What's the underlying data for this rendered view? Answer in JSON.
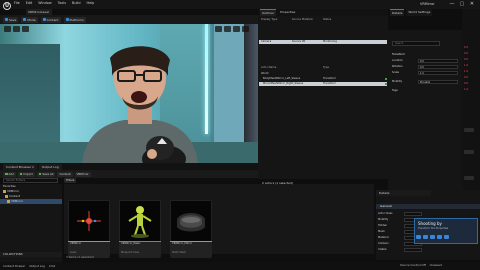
{
  "app": {
    "logo": "U",
    "menu": [
      "File",
      "Edit",
      "Window",
      "Tools",
      "Build",
      "Help"
    ],
    "project_name": "VRMirror",
    "window_controls": [
      "—",
      "▢",
      "✕"
    ],
    "level_tab": "VRMirrorLevel"
  },
  "main_toolbar": {
    "buttons": [
      "Save",
      "Mode",
      "Content",
      "Platforms"
    ]
  },
  "viewport": {
    "scene": "webcam-capture",
    "accent_colors": {
      "light_strip": "#aef6ff",
      "wall": "#5ea9b1"
    }
  },
  "drawer": {
    "tabs": [
      "Content Browser 1",
      "Output Log"
    ]
  },
  "content_browser": {
    "toolbar": [
      "Add",
      "Import",
      "Save All",
      "Content",
      "VRMirror"
    ],
    "search_placeholder": "Search Folders",
    "filter_label": "Filters",
    "tree": [
      {
        "label": "Favorites",
        "selected": false
      },
      {
        "label": "VRMirror",
        "selected": false
      },
      {
        "label": "Content",
        "selected": false
      },
      {
        "label": "VRMirror",
        "selected": true
      }
    ],
    "collections_label": "COLLECTIONS",
    "assets": [
      {
        "name": "VRMirror",
        "type": "Level"
      },
      {
        "name": "VRMirror_Pawn",
        "type": "Blueprint Class"
      },
      {
        "name": "VRMirror_Mirror",
        "type": "Static Mesh"
      }
    ],
    "item_count": "3 items (1 selected)"
  },
  "outliner": {
    "tabs": [
      "Outliner",
      "Properties"
    ],
    "headers": [
      "Display Type",
      "Source Mutation",
      "Status"
    ],
    "top_rows": [
      {
        "c1": "Camera",
        "c2": "Source VR",
        "c3": "Monitoring",
        "selected": true
      }
    ],
    "actor_headers": [
      "Actor Name",
      "Type"
    ],
    "rows": [
      {
        "c1": "World",
        "c2": "",
        "c3": "",
        "selected": false
      },
      {
        "c1": "BodyMeshMirror_Left_Sleeve",
        "c2": "",
        "c3": "Transform",
        "selected": false
      },
      {
        "c1": "MirrorMeshMirror_Right_Sleeve",
        "c2": "",
        "c3": "Transform",
        "selected": true
      }
    ],
    "status": "2 actors (1 selected)"
  },
  "details": {
    "tabs": [
      "Details",
      "World Settings"
    ],
    "search_placeholder": "Search",
    "section": "Transform",
    "rows": [
      {
        "label": "Location",
        "value": "0.0"
      },
      {
        "label": "Rotation",
        "value": "0.0"
      },
      {
        "label": "Scale",
        "value": "1.0"
      },
      {
        "label": "Mobility",
        "value": "Movable"
      },
      {
        "label": "Tags",
        "value": ""
      }
    ],
    "right_values": [
      "0.0",
      "0.0",
      "0.0",
      "1.0",
      "1.0",
      "0.0",
      "0.0",
      "1.0"
    ]
  },
  "bottom_details": {
    "tab": "Details",
    "section": "General",
    "rows": [
      {
        "label": "Actor Class",
        "value": ""
      },
      {
        "label": "Mobility",
        "value": ""
      },
      {
        "label": "Hidden",
        "value": ""
      },
      {
        "label": "Mesh",
        "value": ""
      },
      {
        "label": "Material",
        "value": ""
      },
      {
        "label": "Collision",
        "value": ""
      },
      {
        "label": "Visible",
        "value": ""
      }
    ]
  },
  "tooltip": {
    "title": "Shooting by",
    "subtitle": "Transform Tool Properties"
  },
  "statusbar": {
    "left": [
      "Content Drawer",
      "Output Log",
      "Cmd"
    ],
    "right": [
      "Source Control Off",
      "Unsaved"
    ]
  }
}
